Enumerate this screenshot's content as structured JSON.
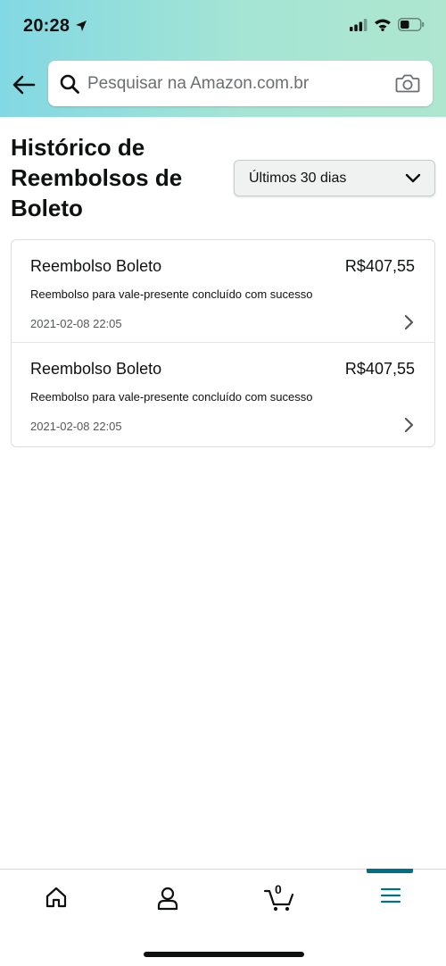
{
  "status_bar": {
    "time": "20:28"
  },
  "search": {
    "placeholder": "Pesquisar na Amazon.com.br"
  },
  "page": {
    "title": "Histórico de Reembolsos de Boleto"
  },
  "filter": {
    "selected": "Últimos 30 dias"
  },
  "refunds": [
    {
      "title": "Reembolso Boleto",
      "amount": "R$407,55",
      "description": "Reembolso para vale-presente concluído com sucesso",
      "date": "2021-02-08 22:05"
    },
    {
      "title": "Reembolso Boleto",
      "amount": "R$407,55",
      "description": "Reembolso para vale-presente concluído com sucesso",
      "date": "2021-02-08 22:05"
    }
  ],
  "bottom_nav": {
    "items": [
      "home-icon",
      "account-icon",
      "cart-icon",
      "menu-icon"
    ],
    "cart_count": "0",
    "active": "menu"
  },
  "colors": {
    "header_gradient_start": "#82d8e3",
    "header_gradient_end": "#aee6cf",
    "accent": "#007185",
    "text": "#0f1111"
  }
}
